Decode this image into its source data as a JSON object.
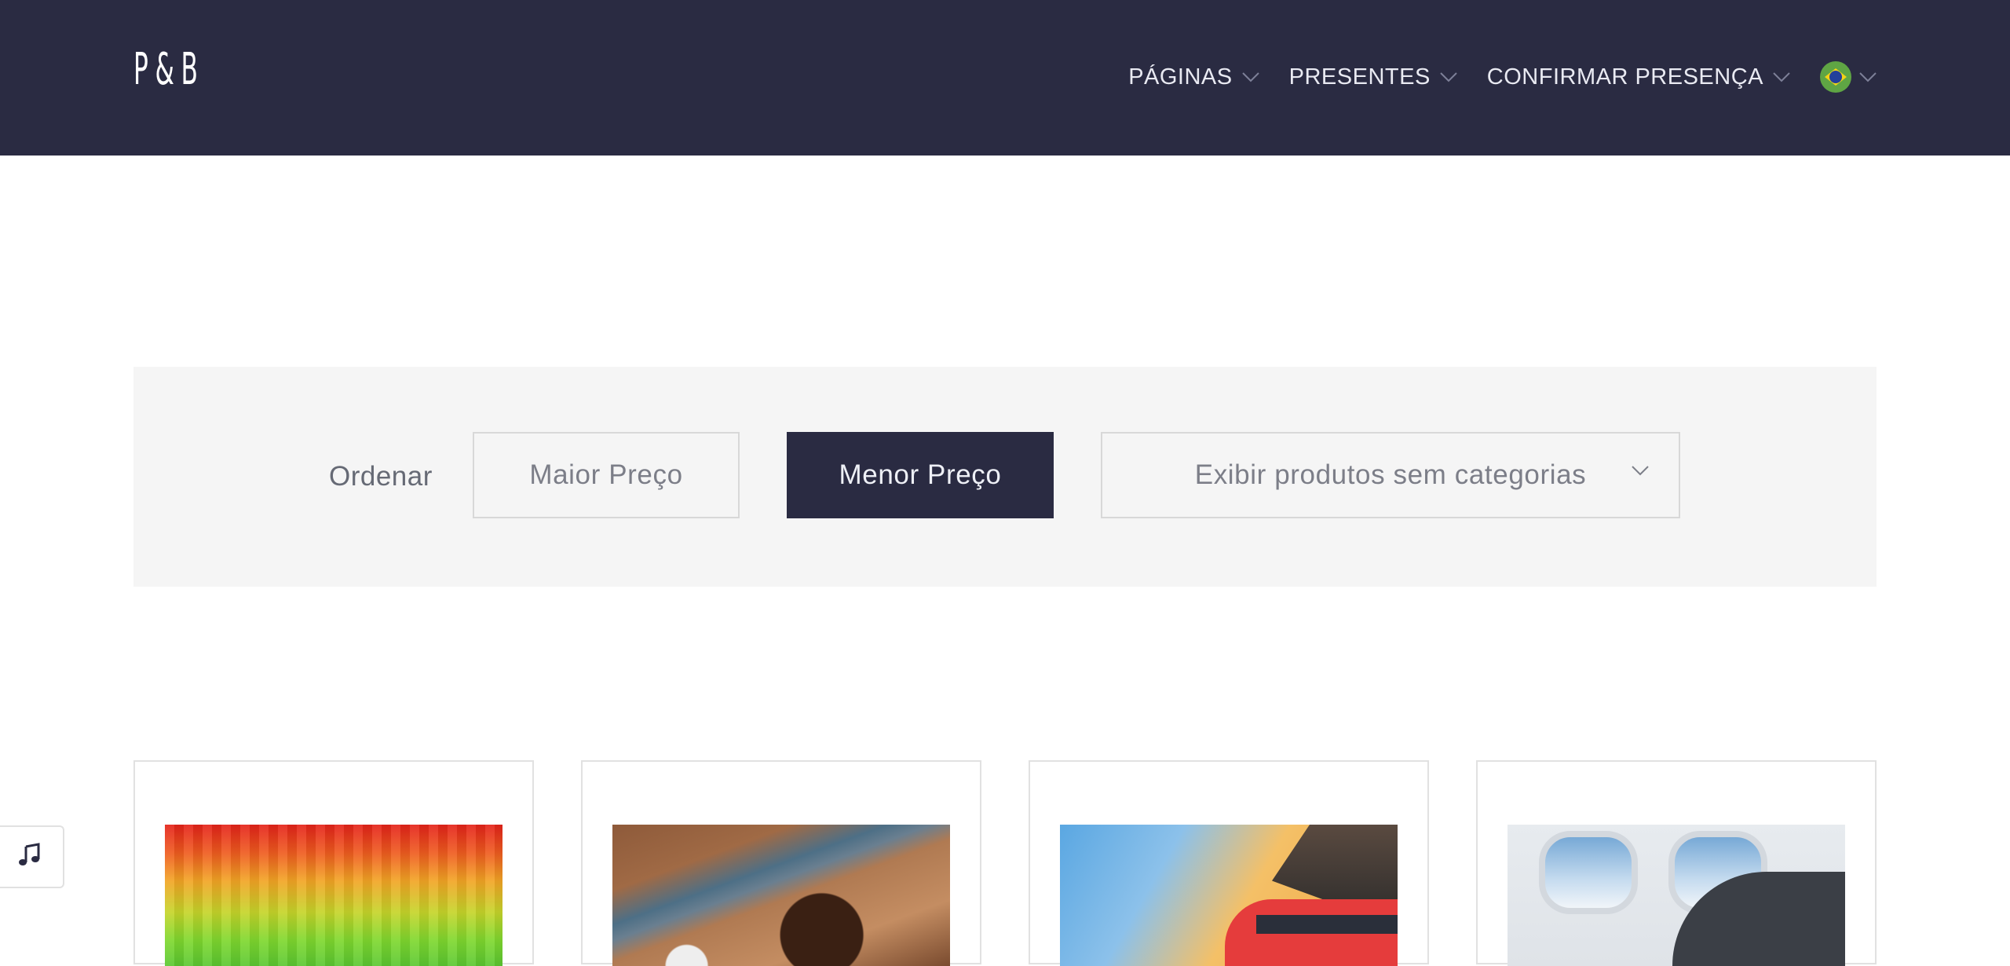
{
  "header": {
    "logo": "P&B",
    "nav": [
      {
        "label": "PÁGINAS"
      },
      {
        "label": "PRESENTES"
      },
      {
        "label": "CONFIRMAR PRESENÇA"
      }
    ],
    "language": {
      "icon": "brazil-flag-icon"
    }
  },
  "sort": {
    "label": "Ordenar",
    "options": [
      "Maior Preço",
      "Menor Preço"
    ],
    "active": "Menor Preço",
    "category_select": "Exibir produtos sem categorias"
  },
  "products": [
    {
      "image": "colorful-pixel-image"
    },
    {
      "image": "chocolate-brigadeiro-image"
    },
    {
      "image": "red-train-image"
    },
    {
      "image": "airplane-seat-image"
    }
  ],
  "music_button": {
    "icon": "music-note-icon"
  },
  "colors": {
    "header_bg": "#2a2b42",
    "sortbar_bg": "#f5f5f5",
    "accent": "#2a2b42",
    "muted_text": "#7c7e88"
  }
}
